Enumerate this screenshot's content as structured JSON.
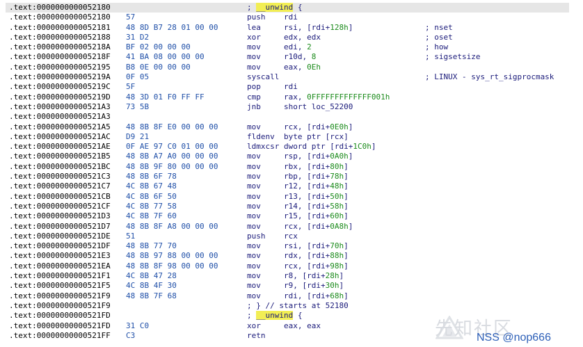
{
  "rows": [
    {
      "addr": ".text:0000000000052180",
      "bytes": "",
      "mnem": "",
      "ops": [],
      "comment": [
        {
          "t": "; ",
          "c": "c-blue"
        },
        {
          "t": "__unwind",
          "c": "c-blue hl"
        },
        {
          "t": " {",
          "c": "c-blue"
        }
      ],
      "selected": true
    },
    {
      "addr": ".text:0000000000052180",
      "bytes": "57",
      "mnem": "push",
      "ops": [
        {
          "t": "rdi",
          "c": "tok-reg"
        }
      ],
      "comment": []
    },
    {
      "addr": ".text:0000000000052181",
      "bytes": "48 8D B7 28 01 00 00",
      "mnem": "lea",
      "ops": [
        {
          "t": "rsi, [rdi+",
          "c": "tok-reg"
        },
        {
          "t": "128h",
          "c": "tok-num"
        },
        {
          "t": "]",
          "c": "tok-reg"
        }
      ],
      "comment": [
        {
          "t": "; nset",
          "c": "c-blue"
        }
      ]
    },
    {
      "addr": ".text:0000000000052188",
      "bytes": "31 D2",
      "mnem": "xor",
      "ops": [
        {
          "t": "edx, edx",
          "c": "tok-reg"
        }
      ],
      "comment": [
        {
          "t": "; oset",
          "c": "c-blue"
        }
      ]
    },
    {
      "addr": ".text:000000000005218A",
      "bytes": "BF 02 00 00 00",
      "mnem": "mov",
      "ops": [
        {
          "t": "edi, ",
          "c": "tok-reg"
        },
        {
          "t": "2",
          "c": "tok-num"
        }
      ],
      "comment": [
        {
          "t": "; how",
          "c": "c-blue"
        }
      ]
    },
    {
      "addr": ".text:000000000005218F",
      "bytes": "41 BA 08 00 00 00",
      "mnem": "mov",
      "ops": [
        {
          "t": "r10d, ",
          "c": "tok-reg"
        },
        {
          "t": "8",
          "c": "tok-num"
        }
      ],
      "comment": [
        {
          "t": "; sigsetsize",
          "c": "c-blue"
        }
      ]
    },
    {
      "addr": ".text:0000000000052195",
      "bytes": "B8 0E 00 00 00",
      "mnem": "mov",
      "ops": [
        {
          "t": "eax, ",
          "c": "tok-reg"
        },
        {
          "t": "0Eh",
          "c": "tok-num"
        }
      ],
      "comment": []
    },
    {
      "addr": ".text:000000000005219A",
      "bytes": "0F 05",
      "mnem": "syscall",
      "ops": [],
      "comment": [
        {
          "t": "; LINUX - sys_rt_sigprocmask",
          "c": "c-blue"
        }
      ]
    },
    {
      "addr": ".text:000000000005219C",
      "bytes": "5F",
      "mnem": "pop",
      "ops": [
        {
          "t": "rdi",
          "c": "tok-reg"
        }
      ],
      "comment": []
    },
    {
      "addr": ".text:000000000005219D",
      "bytes": "48 3D 01 F0 FF FF",
      "mnem": "cmp",
      "ops": [
        {
          "t": "rax, ",
          "c": "tok-reg"
        },
        {
          "t": "0FFFFFFFFFFFFF001h",
          "c": "tok-num"
        }
      ],
      "comment": []
    },
    {
      "addr": ".text:00000000000521A3",
      "bytes": "73 5B",
      "mnem": "jnb",
      "ops": [
        {
          "t": "short loc_52200",
          "c": "tok-sym"
        }
      ],
      "comment": []
    },
    {
      "addr": ".text:00000000000521A3",
      "bytes": "",
      "mnem": "",
      "ops": [],
      "comment": []
    },
    {
      "addr": ".text:00000000000521A5",
      "bytes": "48 8B 8F E0 00 00 00",
      "mnem": "mov",
      "ops": [
        {
          "t": "rcx, [rdi+",
          "c": "tok-reg"
        },
        {
          "t": "0E0h",
          "c": "tok-num"
        },
        {
          "t": "]",
          "c": "tok-reg"
        }
      ],
      "comment": []
    },
    {
      "addr": ".text:00000000000521AC",
      "bytes": "D9 21",
      "mnem": "fldenv",
      "ops": [
        {
          "t": "byte ptr [rcx]",
          "c": "tok-reg"
        }
      ],
      "comment": []
    },
    {
      "addr": ".text:00000000000521AE",
      "bytes": "0F AE 97 C0 01 00 00",
      "mnem": "ldmxcsr",
      "ops": [
        {
          "t": "dword ptr [rdi+",
          "c": "tok-reg"
        },
        {
          "t": "1C0h",
          "c": "tok-num"
        },
        {
          "t": "]",
          "c": "tok-reg"
        }
      ],
      "comment": []
    },
    {
      "addr": ".text:00000000000521B5",
      "bytes": "48 8B A7 A0 00 00 00",
      "mnem": "mov",
      "ops": [
        {
          "t": "rsp, [rdi+",
          "c": "tok-reg"
        },
        {
          "t": "0A0h",
          "c": "tok-num"
        },
        {
          "t": "]",
          "c": "tok-reg"
        }
      ],
      "comment": []
    },
    {
      "addr": ".text:00000000000521BC",
      "bytes": "48 8B 9F 80 00 00 00",
      "mnem": "mov",
      "ops": [
        {
          "t": "rbx, [rdi+",
          "c": "tok-reg"
        },
        {
          "t": "80h",
          "c": "tok-num"
        },
        {
          "t": "]",
          "c": "tok-reg"
        }
      ],
      "comment": []
    },
    {
      "addr": ".text:00000000000521C3",
      "bytes": "48 8B 6F 78",
      "mnem": "mov",
      "ops": [
        {
          "t": "rbp, [rdi+",
          "c": "tok-reg"
        },
        {
          "t": "78h",
          "c": "tok-num"
        },
        {
          "t": "]",
          "c": "tok-reg"
        }
      ],
      "comment": []
    },
    {
      "addr": ".text:00000000000521C7",
      "bytes": "4C 8B 67 48",
      "mnem": "mov",
      "ops": [
        {
          "t": "r12, [rdi+",
          "c": "tok-reg"
        },
        {
          "t": "48h",
          "c": "tok-num"
        },
        {
          "t": "]",
          "c": "tok-reg"
        }
      ],
      "comment": []
    },
    {
      "addr": ".text:00000000000521CB",
      "bytes": "4C 8B 6F 50",
      "mnem": "mov",
      "ops": [
        {
          "t": "r13, [rdi+",
          "c": "tok-reg"
        },
        {
          "t": "50h",
          "c": "tok-num"
        },
        {
          "t": "]",
          "c": "tok-reg"
        }
      ],
      "comment": []
    },
    {
      "addr": ".text:00000000000521CF",
      "bytes": "4C 8B 77 58",
      "mnem": "mov",
      "ops": [
        {
          "t": "r14, [rdi+",
          "c": "tok-reg"
        },
        {
          "t": "58h",
          "c": "tok-num"
        },
        {
          "t": "]",
          "c": "tok-reg"
        }
      ],
      "comment": []
    },
    {
      "addr": ".text:00000000000521D3",
      "bytes": "4C 8B 7F 60",
      "mnem": "mov",
      "ops": [
        {
          "t": "r15, [rdi+",
          "c": "tok-reg"
        },
        {
          "t": "60h",
          "c": "tok-num"
        },
        {
          "t": "]",
          "c": "tok-reg"
        }
      ],
      "comment": []
    },
    {
      "addr": ".text:00000000000521D7",
      "bytes": "48 8B 8F A8 00 00 00",
      "mnem": "mov",
      "ops": [
        {
          "t": "rcx, [rdi+",
          "c": "tok-reg"
        },
        {
          "t": "0A8h",
          "c": "tok-num"
        },
        {
          "t": "]",
          "c": "tok-reg"
        }
      ],
      "comment": []
    },
    {
      "addr": ".text:00000000000521DE",
      "bytes": "51",
      "mnem": "push",
      "ops": [
        {
          "t": "rcx",
          "c": "tok-reg"
        }
      ],
      "comment": []
    },
    {
      "addr": ".text:00000000000521DF",
      "bytes": "48 8B 77 70",
      "mnem": "mov",
      "ops": [
        {
          "t": "rsi, [rdi+",
          "c": "tok-reg"
        },
        {
          "t": "70h",
          "c": "tok-num"
        },
        {
          "t": "]",
          "c": "tok-reg"
        }
      ],
      "comment": []
    },
    {
      "addr": ".text:00000000000521E3",
      "bytes": "48 8B 97 88 00 00 00",
      "mnem": "mov",
      "ops": [
        {
          "t": "rdx, [rdi+",
          "c": "tok-reg"
        },
        {
          "t": "88h",
          "c": "tok-num"
        },
        {
          "t": "]",
          "c": "tok-reg"
        }
      ],
      "comment": []
    },
    {
      "addr": ".text:00000000000521EA",
      "bytes": "48 8B 8F 98 00 00 00",
      "mnem": "mov",
      "ops": [
        {
          "t": "rcx, [rdi+",
          "c": "tok-reg"
        },
        {
          "t": "98h",
          "c": "tok-num"
        },
        {
          "t": "]",
          "c": "tok-reg"
        }
      ],
      "comment": []
    },
    {
      "addr": ".text:00000000000521F1",
      "bytes": "4C 8B 47 28",
      "mnem": "mov",
      "ops": [
        {
          "t": "r8, [rdi+",
          "c": "tok-reg"
        },
        {
          "t": "28h",
          "c": "tok-num"
        },
        {
          "t": "]",
          "c": "tok-reg"
        }
      ],
      "comment": []
    },
    {
      "addr": ".text:00000000000521F5",
      "bytes": "4C 8B 4F 30",
      "mnem": "mov",
      "ops": [
        {
          "t": "r9, [rdi+",
          "c": "tok-reg"
        },
        {
          "t": "30h",
          "c": "tok-num"
        },
        {
          "t": "]",
          "c": "tok-reg"
        }
      ],
      "comment": []
    },
    {
      "addr": ".text:00000000000521F9",
      "bytes": "48 8B 7F 68",
      "mnem": "mov",
      "ops": [
        {
          "t": "rdi, [rdi+",
          "c": "tok-reg"
        },
        {
          "t": "68h",
          "c": "tok-num"
        },
        {
          "t": "]",
          "c": "tok-reg"
        }
      ],
      "comment": []
    },
    {
      "addr": ".text:00000000000521F9",
      "bytes": "",
      "mnem": "",
      "ops": [],
      "comment": [
        {
          "t": "; } // starts at 52180",
          "c": "c-blue"
        }
      ]
    },
    {
      "addr": ".text:00000000000521FD",
      "bytes": "",
      "mnem": "",
      "ops": [],
      "comment": [
        {
          "t": "; ",
          "c": "c-blue"
        },
        {
          "t": "__unwind",
          "c": "c-blue hl"
        },
        {
          "t": " {",
          "c": "c-blue"
        }
      ]
    },
    {
      "addr": ".text:00000000000521FD",
      "bytes": "31 C0",
      "mnem": "xor",
      "ops": [
        {
          "t": "eax, eax",
          "c": "tok-reg"
        }
      ],
      "comment": []
    },
    {
      "addr": ".text:00000000000521FF",
      "bytes": "C3",
      "mnem": "retn",
      "ops": [],
      "comment": []
    }
  ],
  "watermark": {
    "cn_text": "先知社区",
    "nss_text": "NSS @nop666"
  },
  "colors": {
    "address": "#000000",
    "bytes": "#1f4fa8",
    "mnemonic": "#1a1a7a",
    "number": "#1a8a1a",
    "highlight": "#f2ee54",
    "selected_row": "#e6e6e6"
  }
}
